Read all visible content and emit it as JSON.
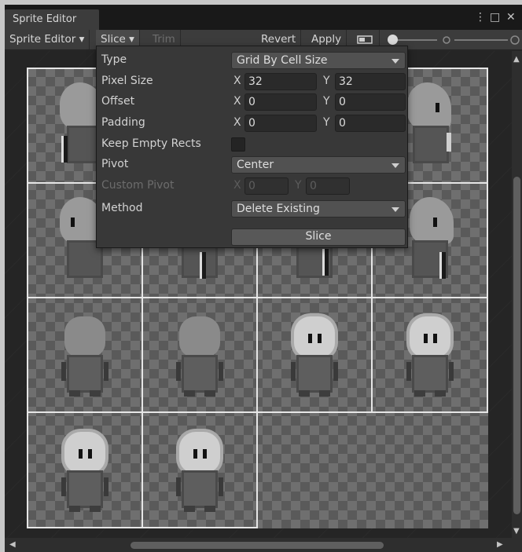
{
  "window": {
    "tab_title": "Sprite Editor",
    "menu_glyph": "⋮",
    "maximize_glyph": "□",
    "close_glyph": "✕"
  },
  "toolbar": {
    "mode_dropdown": "Sprite Editor ▾",
    "slice_menu": "Slice ▾",
    "trim": "Trim",
    "revert": "Revert",
    "apply": "Apply",
    "zoom_level": 0.0
  },
  "slice_popup": {
    "type": {
      "label": "Type",
      "value": "Grid By Cell Size"
    },
    "pixel_size": {
      "label": "Pixel Size",
      "x_label": "X",
      "x": "32",
      "y_label": "Y",
      "y": "32"
    },
    "offset": {
      "label": "Offset",
      "x_label": "X",
      "x": "0",
      "y_label": "Y",
      "y": "0"
    },
    "padding": {
      "label": "Padding",
      "x_label": "X",
      "x": "0",
      "y_label": "Y",
      "y": "0"
    },
    "keep_empty_rects": {
      "label": "Keep Empty Rects",
      "checked": false
    },
    "pivot": {
      "label": "Pivot",
      "value": "Center"
    },
    "custom_pivot": {
      "label": "Custom Pivot",
      "x_label": "X",
      "x": "0",
      "y_label": "Y",
      "y": "0"
    },
    "method": {
      "label": "Method",
      "value": "Delete Existing"
    },
    "slice_button": "Slice"
  },
  "scroll": {
    "up": "▲",
    "down": "▼",
    "left": "◀",
    "right": "▶"
  }
}
